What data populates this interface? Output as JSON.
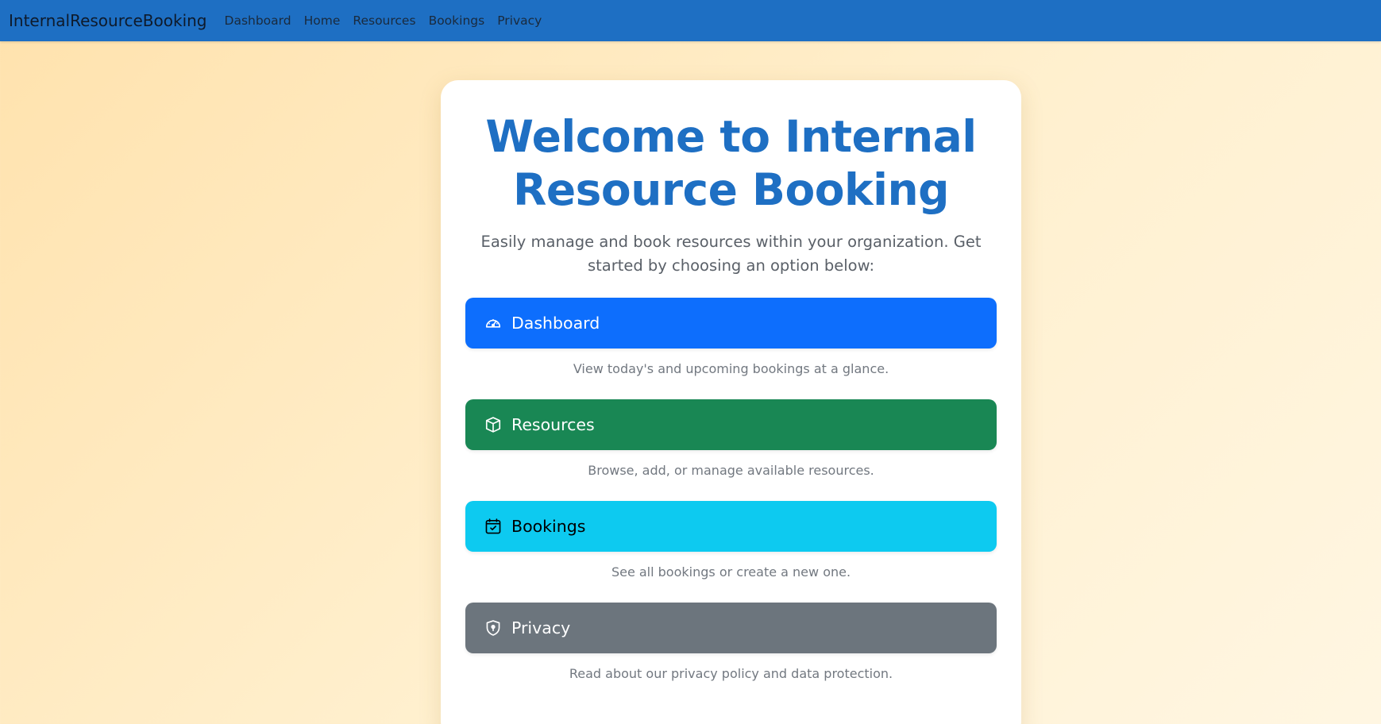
{
  "navbar": {
    "brand": "InternalResourceBooking",
    "links": [
      "Dashboard",
      "Home",
      "Resources",
      "Bookings",
      "Privacy"
    ],
    "background": "#1e6fc3"
  },
  "hero": {
    "title": "Welcome to Internal Resource Booking",
    "subtitle": "Easily manage and book resources within your organization. Get started by choosing an option below:"
  },
  "options": [
    {
      "label": "Dashboard",
      "icon": "speedometer-icon",
      "description": "View today's and upcoming bookings at a glance.",
      "color": "#0d6efd",
      "text_color": "#ffffff"
    },
    {
      "label": "Resources",
      "icon": "box-icon",
      "description": "Browse, add, or manage available resources.",
      "color": "#198754",
      "text_color": "#ffffff"
    },
    {
      "label": "Bookings",
      "icon": "calendar-check-icon",
      "description": "See all bookings or create a new one.",
      "color": "#0dcaf0",
      "text_color": "#000000"
    },
    {
      "label": "Privacy",
      "icon": "shield-lock-icon",
      "description": "Read about our privacy policy and data protection.",
      "color": "#6c757d",
      "text_color": "#ffffff"
    }
  ]
}
